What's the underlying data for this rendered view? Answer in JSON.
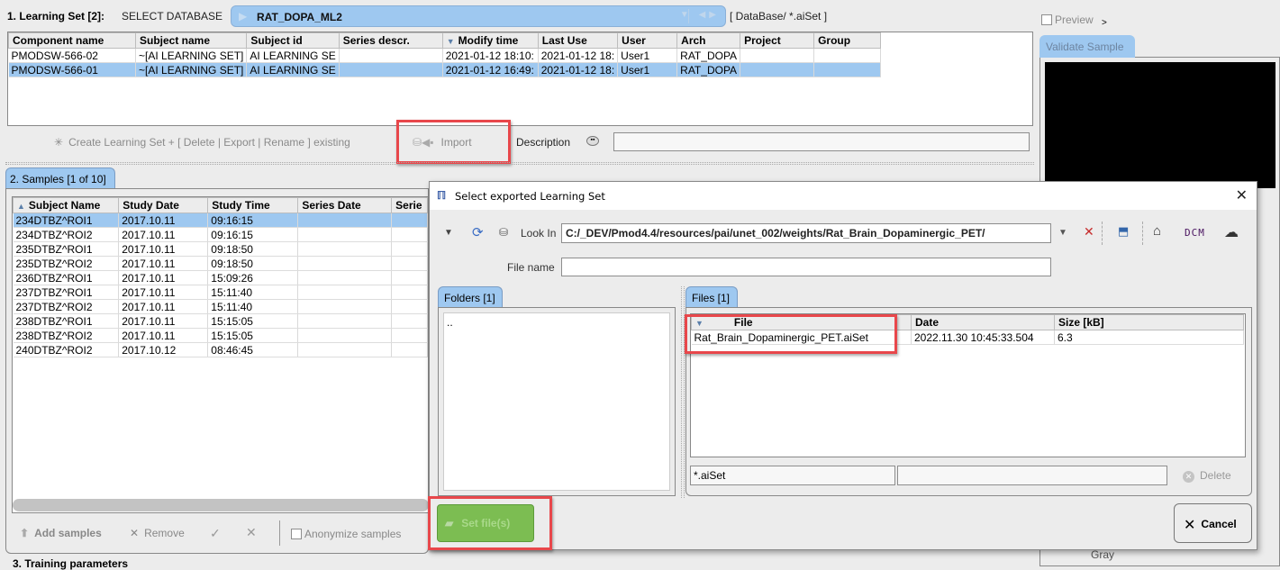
{
  "learning_set": {
    "label": "1. Learning Set [2]:",
    "select_db_label": "SELECT DATABASE",
    "database": "RAT_DOPA_ML2",
    "db_path": "[  DataBase/ *.aiSet  ]",
    "columns": [
      "Component name",
      "Subject name",
      "Subject id",
      "Series descr.",
      "Modify time",
      "Last Use",
      "User",
      "Arch",
      "Project",
      "Group"
    ],
    "rows": [
      [
        "PMODSW-566-02",
        "~[AI LEARNING SET]",
        "AI LEARNING SE",
        "",
        "2021-01-12 18:10:",
        "2021-01-12 18:",
        "User1",
        "RAT_DOPA",
        "",
        ""
      ],
      [
        "PMODSW-566-01",
        "~[AI LEARNING SET]",
        "AI LEARNING SE",
        "",
        "2021-01-12 16:49:",
        "2021-01-12 18:",
        "User1",
        "RAT_DOPA",
        "",
        ""
      ]
    ],
    "selected_row": 1,
    "create_label": "Create Learning Set + [ Delete | Export | Rename ] existing",
    "import_label": "Import",
    "description_label": "Description",
    "description_value": ""
  },
  "samples": {
    "tab_label": "2. Samples  [1 of 10]",
    "columns": [
      "Subject Name",
      "Study Date",
      "Study Time",
      "Series Date",
      "Serie"
    ],
    "rows": [
      [
        "234DTBZ^ROI1",
        "2017.10.11",
        "09:16:15",
        "",
        ""
      ],
      [
        "234DTBZ^ROI2",
        "2017.10.11",
        "09:16:15",
        "",
        ""
      ],
      [
        "235DTBZ^ROI1",
        "2017.10.11",
        "09:18:50",
        "",
        ""
      ],
      [
        "235DTBZ^ROI2",
        "2017.10.11",
        "09:18:50",
        "",
        ""
      ],
      [
        "236DTBZ^ROI1",
        "2017.10.11",
        "15:09:26",
        "",
        ""
      ],
      [
        "237DTBZ^ROI1",
        "2017.10.11",
        "15:11:40",
        "",
        ""
      ],
      [
        "237DTBZ^ROI2",
        "2017.10.11",
        "15:11:40",
        "",
        ""
      ],
      [
        "238DTBZ^ROI1",
        "2017.10.11",
        "15:15:05",
        "",
        ""
      ],
      [
        "238DTBZ^ROI2",
        "2017.10.11",
        "15:15:05",
        "",
        ""
      ],
      [
        "240DTBZ^ROI2",
        "2017.10.12",
        "08:46:45",
        "",
        ""
      ]
    ],
    "selected_row": 0,
    "add_label": "Add samples",
    "remove_label": "Remove",
    "anonymize_label": "Anonymize samples",
    "anonymize_checked": false
  },
  "training": {
    "label": "3. Training parameters"
  },
  "right_panel": {
    "preview_label": "Preview",
    "preview_checked": false,
    "preview_arrow": ">",
    "validate_tab": "Validate Sample",
    "colormap": "Gray"
  },
  "dialog": {
    "title": "Select exported Learning Set",
    "look_in_label": "Look In",
    "look_in_value": "C:/_DEV/Pmod4.4/resources/pai/unet_002/weights/Rat_Brain_Dopaminergic_PET/",
    "dcm_label": "DCM",
    "file_name_label": "File name",
    "file_name_value": "",
    "folders_tab": "Folders [1]",
    "folders": [
      ".."
    ],
    "files_tab": "Files [1]",
    "file_columns": [
      "File",
      "Date",
      "Size [kB]"
    ],
    "files": [
      [
        "Rat_Brain_Dopaminergic_PET.aiSet",
        "2022.11.30 10:45:33.504",
        "6.3"
      ]
    ],
    "filter_value": "*.aiSet",
    "filter2_value": "",
    "delete_label": "Delete",
    "set_files_label": "Set file(s)",
    "cancel_label": "Cancel"
  },
  "highlight_color": "#e8474b",
  "selection_color": "#9ec8f0",
  "set_files_color": "#7cbd52"
}
